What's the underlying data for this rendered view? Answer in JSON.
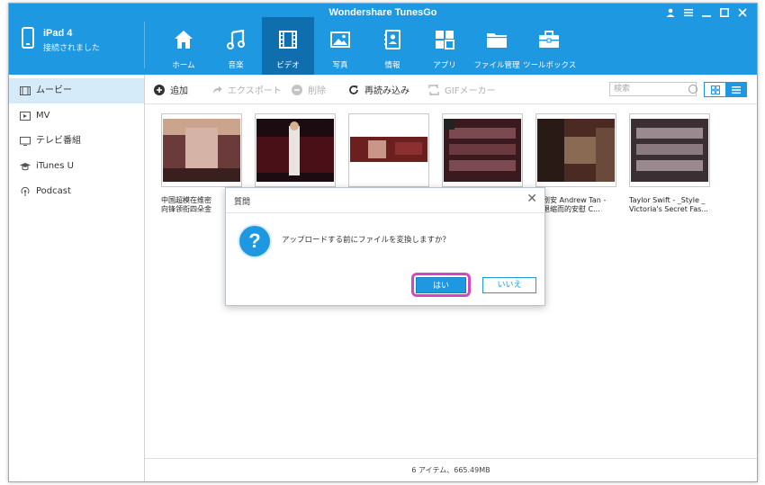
{
  "app": {
    "title": "Wondershare TunesGo"
  },
  "window_controls": [
    "user-icon",
    "menu-icon",
    "minimize-icon",
    "maximize-icon",
    "close-icon"
  ],
  "device": {
    "name": "iPad 4",
    "status": "接続されました"
  },
  "nav": {
    "items": [
      {
        "label": "ホーム",
        "icon": "home-icon"
      },
      {
        "label": "音楽",
        "icon": "music-icon"
      },
      {
        "label": "ビデオ",
        "icon": "video-icon",
        "active": true
      },
      {
        "label": "写真",
        "icon": "photo-icon"
      },
      {
        "label": "情報",
        "icon": "contacts-icon"
      },
      {
        "label": "アプリ",
        "icon": "apps-icon"
      },
      {
        "label": "ファイル管理",
        "icon": "folder-icon"
      },
      {
        "label": "ツールボックス",
        "icon": "toolbox-icon"
      }
    ]
  },
  "sidebar": {
    "items": [
      {
        "label": "ムービー",
        "icon": "film-icon",
        "active": true
      },
      {
        "label": "MV",
        "icon": "mv-icon"
      },
      {
        "label": "テレビ番組",
        "icon": "tv-icon"
      },
      {
        "label": "iTunes U",
        "icon": "graduation-cap-icon"
      },
      {
        "label": "Podcast",
        "icon": "podcast-icon"
      }
    ]
  },
  "toolbar": {
    "add": "追加",
    "export": "エクスポート",
    "delete": "削除",
    "refresh": "再読み込み",
    "gif": "GIFメーカー",
    "search_placeholder": "検索"
  },
  "videos": [
    {
      "label1": "中国超模在维密",
      "label2": "向锋领衔四朵金"
    },
    {
      "label1": "",
      "label2": ""
    },
    {
      "label1": "",
      "label2": ""
    },
    {
      "label1": "",
      "label2": ""
    },
    {
      "label1": "韩剧安 Andrew Tan -",
      "label2": "怎退缩而的安慰 C..."
    },
    {
      "label1": "Taylor Swift - _Style _",
      "label2": "Victoria's Secret Fas..."
    }
  ],
  "status_bar": {
    "text": "6 アイテム、665.49MB"
  },
  "dialog": {
    "title": "質問",
    "message": "アップロードする前にファイルを変換しますか？",
    "yes": "はい",
    "no": "いいえ"
  },
  "colors": {
    "accent": "#1e98e0",
    "active_nav": "#0f6fae",
    "highlight": "#d248c4"
  }
}
